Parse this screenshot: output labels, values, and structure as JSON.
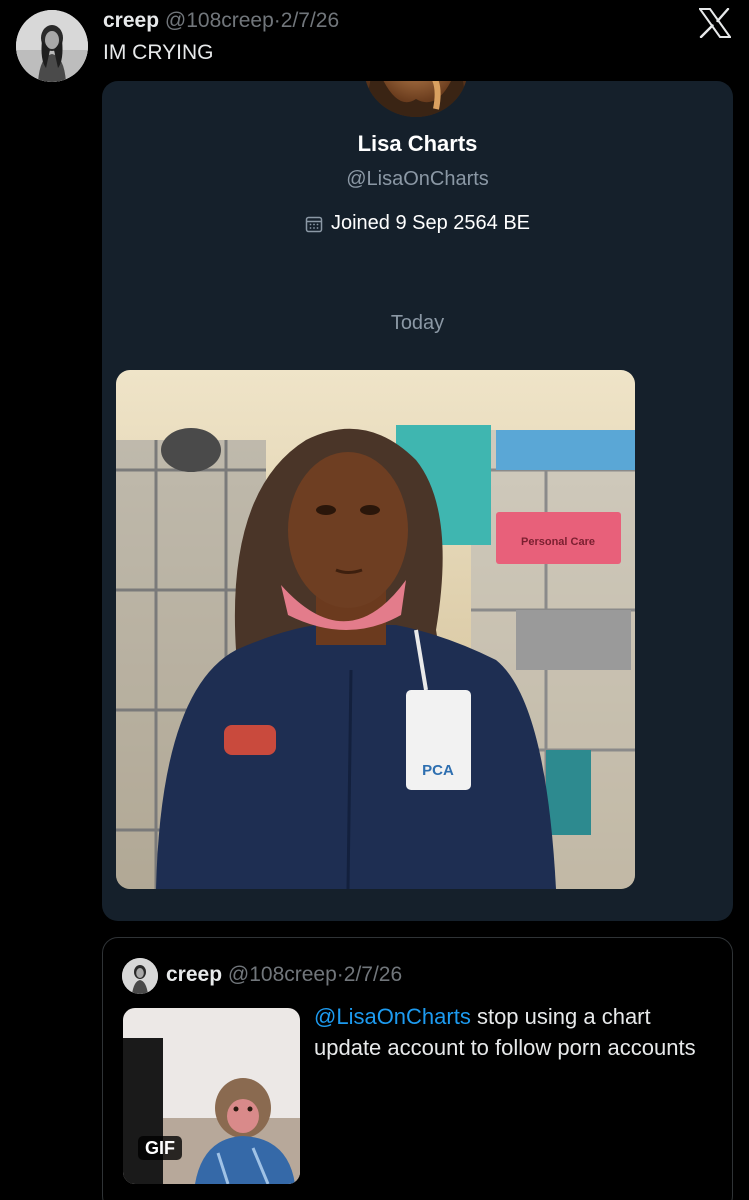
{
  "tweet": {
    "author_name": "creep",
    "author_handle": "@108creep",
    "separator": "·",
    "date": "2/7/26",
    "text": "IM CRYING"
  },
  "embedded_card": {
    "profile_name": "Lisa Charts",
    "profile_handle": "@LisaOnCharts",
    "joined_text": "Joined 9 Sep 2564 BE",
    "divider_label": "Today",
    "photo_sign_text": "Personal Care",
    "photo_badge_text": "PCA"
  },
  "quoted_tweet": {
    "author_name": "creep",
    "author_handle": "@108creep",
    "separator": "·",
    "date": "2/7/26",
    "mention": "@LisaOnCharts",
    "text": " stop using a chart update account to follow porn accounts",
    "media_badge": "GIF"
  },
  "icons": {
    "platform_logo": "x-logo-icon",
    "calendar": "calendar-icon"
  },
  "colors": {
    "background": "#000000",
    "card_background": "#15202b",
    "muted_text": "#71767b",
    "link": "#1d9bf0"
  }
}
